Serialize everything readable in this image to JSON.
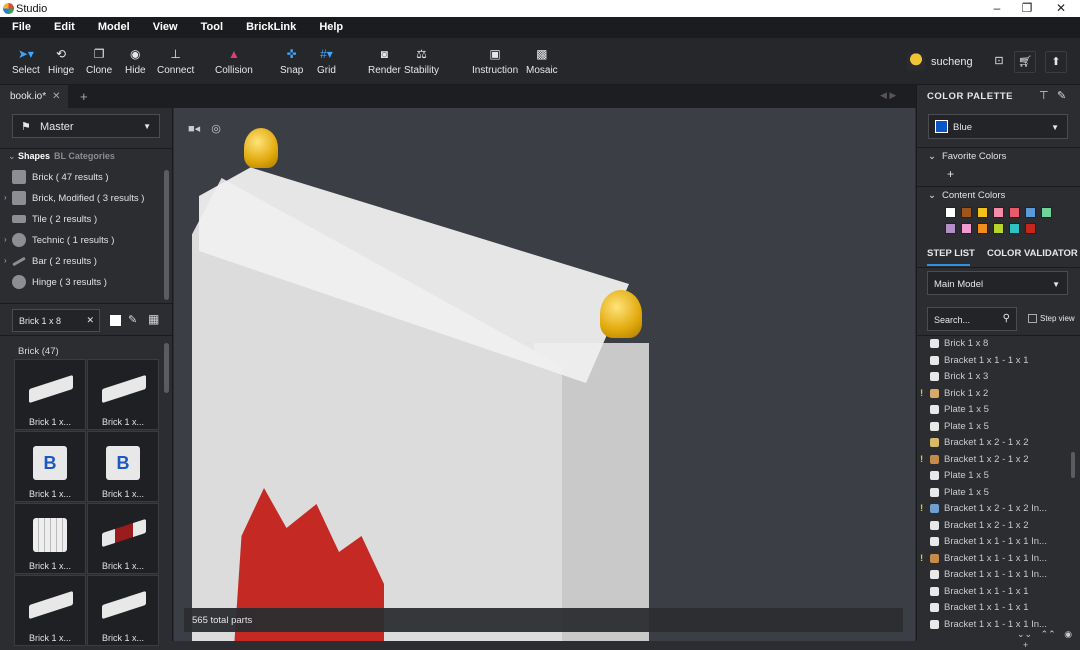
{
  "window": {
    "title": "Studio",
    "minimize": "–",
    "restore": "❐",
    "close": "✕"
  },
  "menu": [
    "File",
    "Edit",
    "Model",
    "View",
    "Tool",
    "BrickLink",
    "Help"
  ],
  "toolbar": {
    "select": "Select",
    "hinge": "Hinge",
    "clone": "Clone",
    "hide": "Hide",
    "connect": "Connect",
    "collision": "Collision",
    "snap": "Snap",
    "grid": "Grid",
    "render": "Render",
    "stability": "Stability",
    "instruction": "Instruction",
    "mosaic": "Mosaic"
  },
  "user": {
    "name": "sucheng"
  },
  "tab": {
    "name": "book.io*",
    "close": "✕",
    "add": "+"
  },
  "left": {
    "master": "Master",
    "tabs": {
      "shapes": "Shapes",
      "bl": "BL Categories"
    },
    "categories": [
      {
        "label": "Brick ( 47 results )"
      },
      {
        "label": "Brick, Modified ( 3 results )"
      },
      {
        "label": "Tile ( 2 results )"
      },
      {
        "label": "Technic ( 1 results )"
      },
      {
        "label": "Bar ( 2 results )"
      },
      {
        "label": "Hinge ( 3 results )"
      }
    ],
    "search_value": "Brick 1 x 8",
    "search_clear": "✕",
    "section": "Brick (47)",
    "parts": [
      "Brick 1 x...",
      "Brick 1 x...",
      "Brick 1 x...",
      "Brick 1 x...",
      "Brick 1 x...",
      "Brick 1 x...",
      "Brick 1 x...",
      "Brick 1 x..."
    ]
  },
  "viewport": {
    "total": "565 total parts"
  },
  "right": {
    "color_palette": "COLOR PALETTE",
    "selected_color": "Blue",
    "favorite_colors": "Favorite Colors",
    "add": "+",
    "content_colors": "Content Colors",
    "swatches": [
      "#ffffff",
      "#a0551a",
      "#f2c21b",
      "#f48ba8",
      "#e95b6a",
      "#5b9bd8",
      "#6ed49a",
      "#b48ec6",
      "#f29ad0",
      "#f28c1b",
      "#b8d42a",
      "#2fc2c4",
      "#c4281c"
    ],
    "step_list": "STEP LIST",
    "color_validator": "COLOR VALIDATOR",
    "model": "Main Model",
    "search_placeholder": "Search...",
    "step_view": "Step view",
    "steps": [
      {
        "label": "Brick 1 x 8",
        "color": "#e8e8e8",
        "warn": ""
      },
      {
        "label": "Bracket 1 x 1 - 1 x 1",
        "color": "#e8e8e8",
        "warn": ""
      },
      {
        "label": "Brick 1 x 3",
        "color": "#e8e8e8",
        "warn": ""
      },
      {
        "label": "Brick 1 x 2",
        "color": "#d9a96a",
        "warn": "!"
      },
      {
        "label": "Plate 1 x 5",
        "color": "#e8e8e8",
        "warn": ""
      },
      {
        "label": "Plate 1 x 5",
        "color": "#e8e8e8",
        "warn": ""
      },
      {
        "label": "Bracket 1 x 2 - 1 x 2",
        "color": "#d7b96a",
        "warn": ""
      },
      {
        "label": "Bracket 1 x 2 - 1 x 2",
        "color": "#c48b4a",
        "warn": "!"
      },
      {
        "label": "Plate 1 x 5",
        "color": "#e8e8e8",
        "warn": ""
      },
      {
        "label": "Plate 1 x 5",
        "color": "#e8e8e8",
        "warn": ""
      },
      {
        "label": "Bracket 1 x 2 - 1 x 2 In...",
        "color": "#6f9ed0",
        "warn": "!"
      },
      {
        "label": "Bracket 1 x 2 - 1 x 2",
        "color": "#e8e8e8",
        "warn": ""
      },
      {
        "label": "Bracket 1 x 1 - 1 x 1 In...",
        "color": "#e8e8e8",
        "warn": ""
      },
      {
        "label": "Bracket 1 x 1 - 1 x 1 In...",
        "color": "#c48b4a",
        "warn": "!"
      },
      {
        "label": "Bracket 1 x 1 - 1 x 1 In...",
        "color": "#e8e8e8",
        "warn": ""
      },
      {
        "label": "Bracket 1 x 1 - 1 x 1",
        "color": "#e8e8e8",
        "warn": ""
      },
      {
        "label": "Bracket 1 x 1 - 1 x 1",
        "color": "#e8e8e8",
        "warn": ""
      },
      {
        "label": "Bracket 1 x 1 - 1 x 1 In...",
        "color": "#e8e8e8",
        "warn": ""
      }
    ]
  }
}
